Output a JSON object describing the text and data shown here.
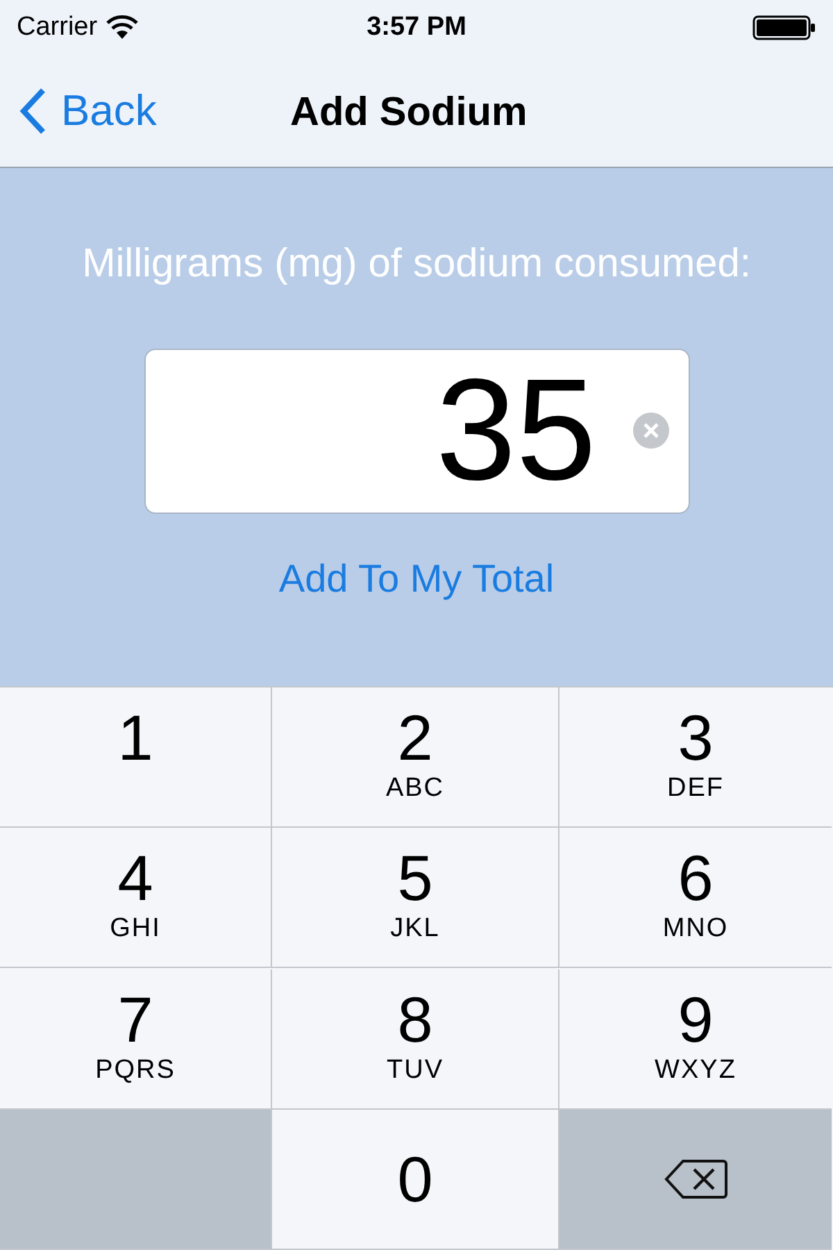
{
  "status_bar": {
    "carrier": "Carrier",
    "time": "3:57 PM"
  },
  "nav": {
    "back": "Back",
    "title": "Add Sodium"
  },
  "prompt": "Milligrams (mg) of sodium consumed:",
  "field": {
    "value": "35"
  },
  "action": "Add To My Total",
  "keypad": [
    {
      "kind": "digit",
      "digit": "1"
    },
    {
      "kind": "digit",
      "digit": "2",
      "letters": "ABC"
    },
    {
      "kind": "digit",
      "digit": "3",
      "letters": "DEF"
    },
    {
      "kind": "digit",
      "digit": "4",
      "letters": "GHI"
    },
    {
      "kind": "digit",
      "digit": "5",
      "letters": "JKL"
    },
    {
      "kind": "digit",
      "digit": "6",
      "letters": "MNO"
    },
    {
      "kind": "digit",
      "digit": "7",
      "letters": "PQRS"
    },
    {
      "kind": "digit",
      "digit": "8",
      "letters": "TUV"
    },
    {
      "kind": "digit",
      "digit": "9",
      "letters": "WXYZ"
    },
    {
      "kind": "blank"
    },
    {
      "kind": "digit",
      "digit": "0"
    },
    {
      "kind": "delete"
    }
  ]
}
